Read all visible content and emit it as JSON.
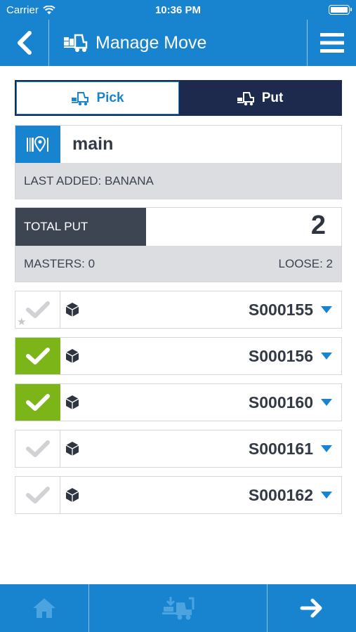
{
  "status_bar": {
    "carrier": "Carrier",
    "time": "10:36 PM"
  },
  "header": {
    "title": "Manage Move"
  },
  "tabs": [
    {
      "label": "Pick",
      "active": false
    },
    {
      "label": "Put",
      "active": true
    }
  ],
  "location": {
    "name": "main",
    "last_added": "LAST ADDED: BANANA"
  },
  "totals": {
    "label": "TOTAL PUT",
    "value": "2",
    "masters": "MASTERS: 0",
    "loose": "LOOSE: 2"
  },
  "items": [
    {
      "code": "S000155",
      "checked": false,
      "starred": true
    },
    {
      "code": "S000156",
      "checked": true,
      "starred": false
    },
    {
      "code": "S000160",
      "checked": true,
      "starred": false
    },
    {
      "code": "S000161",
      "checked": false,
      "starred": false
    },
    {
      "code": "S000162",
      "checked": false,
      "starred": false
    }
  ],
  "colors": {
    "brand_blue": "#1883cf",
    "navy": "#1e2a4d",
    "check_green": "#7cb518",
    "dark_gray": "#3d4553"
  },
  "icons": {
    "back": "chevron-left-icon",
    "menu": "hamburger-icon",
    "forklift": "forklift-icon",
    "location": "location-pin-icon",
    "box": "box-icon",
    "caret": "caret-down-icon",
    "home": "home-icon",
    "next": "arrow-right-icon"
  }
}
